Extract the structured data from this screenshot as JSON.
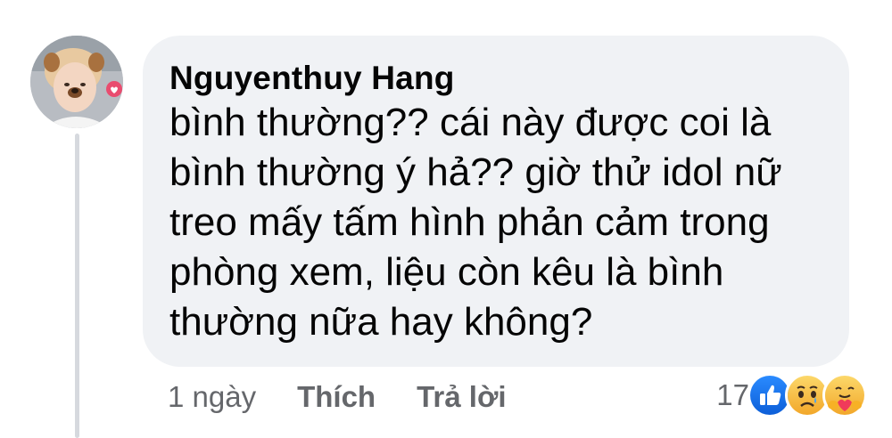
{
  "comment": {
    "author": "Nguyenthuy Hang",
    "text": "bình thường?? cái này được coi là bình thường ý hả?? giờ thử idol nữ treo mấy tấm hình phản cảm trong phòng xem, liệu còn kêu là bình thường nữa hay không?",
    "time": "1 ngày",
    "like_label": "Thích",
    "reply_label": "Trả lời",
    "reaction_count": "17",
    "reactions": [
      "like-icon",
      "sad-icon",
      "care-icon"
    ]
  },
  "colors": {
    "bubble": "#f0f2f5",
    "text": "#050505",
    "secondary_text": "#65676b",
    "like_blue": "#1877f2",
    "emoji_yellow": "#f7b125"
  }
}
